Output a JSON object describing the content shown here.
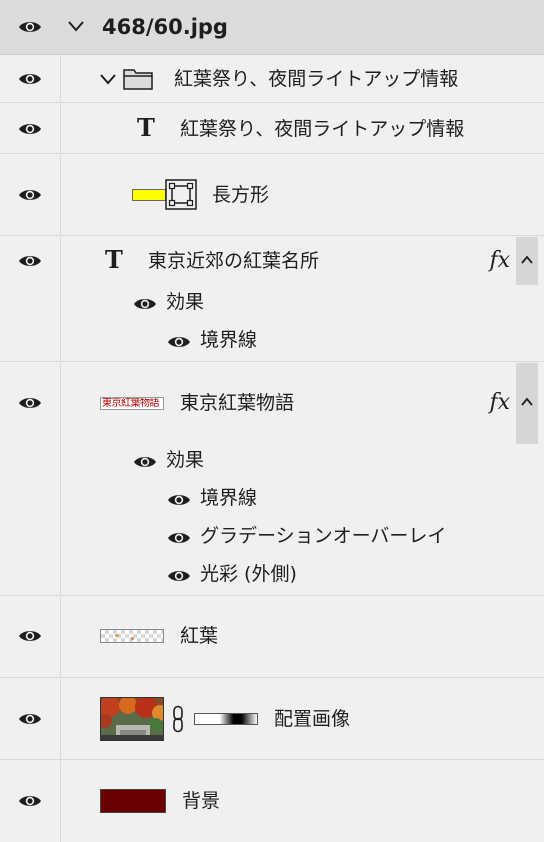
{
  "document": {
    "title": "468/60.jpg"
  },
  "layers": {
    "group": {
      "name": "紅葉祭り、夜間ライトアップ情報"
    },
    "group_text": {
      "name": "紅葉祭り、夜間ライトアップ情報"
    },
    "rect": {
      "name": "長方形"
    },
    "text1": {
      "name": "東京近郊の紅葉名所",
      "fx": "fx",
      "effects_label": "効果",
      "effects": [
        "境界線"
      ]
    },
    "text2": {
      "name": "東京紅葉物語",
      "fx": "fx",
      "effects_label": "効果",
      "effects": [
        "境界線",
        "グラデーションオーバーレイ",
        "光彩 (外側)"
      ],
      "thumb_text": "東京紅葉物語"
    },
    "koyo": {
      "name": "紅葉"
    },
    "placed": {
      "name": "配置画像"
    },
    "background": {
      "name": "背景",
      "color": "#6b0000"
    }
  },
  "colors": {
    "panel_bg": "#f0f0f0",
    "header_bg": "#dcdcdc",
    "rect_fill": "#ffff00"
  }
}
